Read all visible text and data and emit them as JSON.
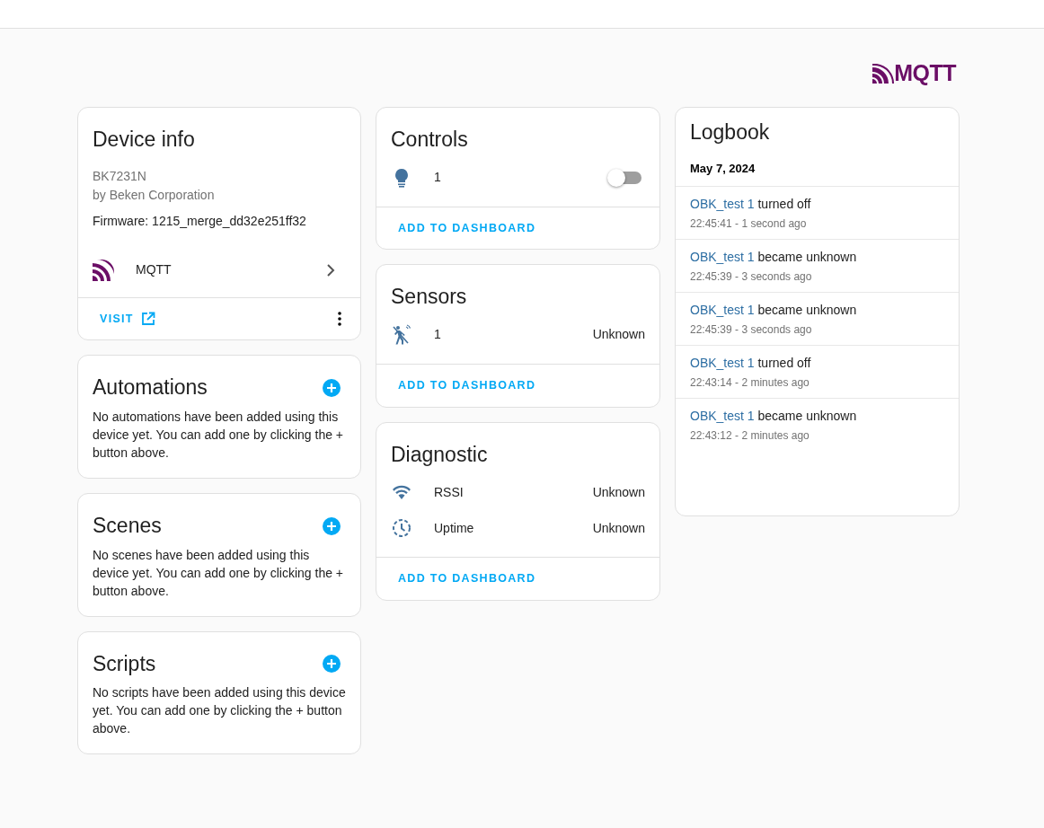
{
  "logo": {
    "text": "MQTT"
  },
  "device_info": {
    "title": "Device info",
    "model": "BK7231N",
    "manufacturer": "by Beken Corporation",
    "firmware": "Firmware: 1215_merge_dd32e251ff32",
    "integration": "MQTT",
    "visit_button": "VISIT"
  },
  "related": [
    {
      "title": "Automations",
      "text": "No automations have been added using this device yet. You can add one by clicking the + button above."
    },
    {
      "title": "Scenes",
      "text": "No scenes have been added using this device yet. You can add one by clicking the + button above."
    },
    {
      "title": "Scripts",
      "text": "No scripts have been added using this device yet. You can add one by clicking the + button above."
    }
  ],
  "entity_cards": [
    {
      "title": "Controls",
      "entities": [
        {
          "kind": "toggle",
          "name": "1",
          "on": false
        }
      ],
      "action": "ADD TO DASHBOARD"
    },
    {
      "title": "Sensors",
      "entities": [
        {
          "kind": "state",
          "name": "1",
          "state": "Unknown"
        }
      ],
      "action": "ADD TO DASHBOARD"
    },
    {
      "title": "Diagnostic",
      "entities": [
        {
          "kind": "state",
          "name": "RSSI",
          "state": "Unknown"
        },
        {
          "kind": "state",
          "name": "Uptime",
          "state": "Unknown"
        }
      ],
      "action": "ADD TO DASHBOARD"
    }
  ],
  "logbook": {
    "title": "Logbook",
    "date": "May 7, 2024",
    "entries": [
      {
        "entity": "OBK_test 1",
        "message": "turned off",
        "time": "22:45:41 - 1 second ago"
      },
      {
        "entity": "OBK_test 1",
        "message": "became unknown",
        "time": "22:45:39 - 3 seconds ago"
      },
      {
        "entity": "OBK_test 1",
        "message": "became unknown",
        "time": "22:45:39 - 3 seconds ago"
      },
      {
        "entity": "OBK_test 1",
        "message": "turned off",
        "time": "22:43:14 - 2 minutes ago"
      },
      {
        "entity": "OBK_test 1",
        "message": "became unknown",
        "time": "22:43:12 - 2 minutes ago"
      }
    ]
  }
}
